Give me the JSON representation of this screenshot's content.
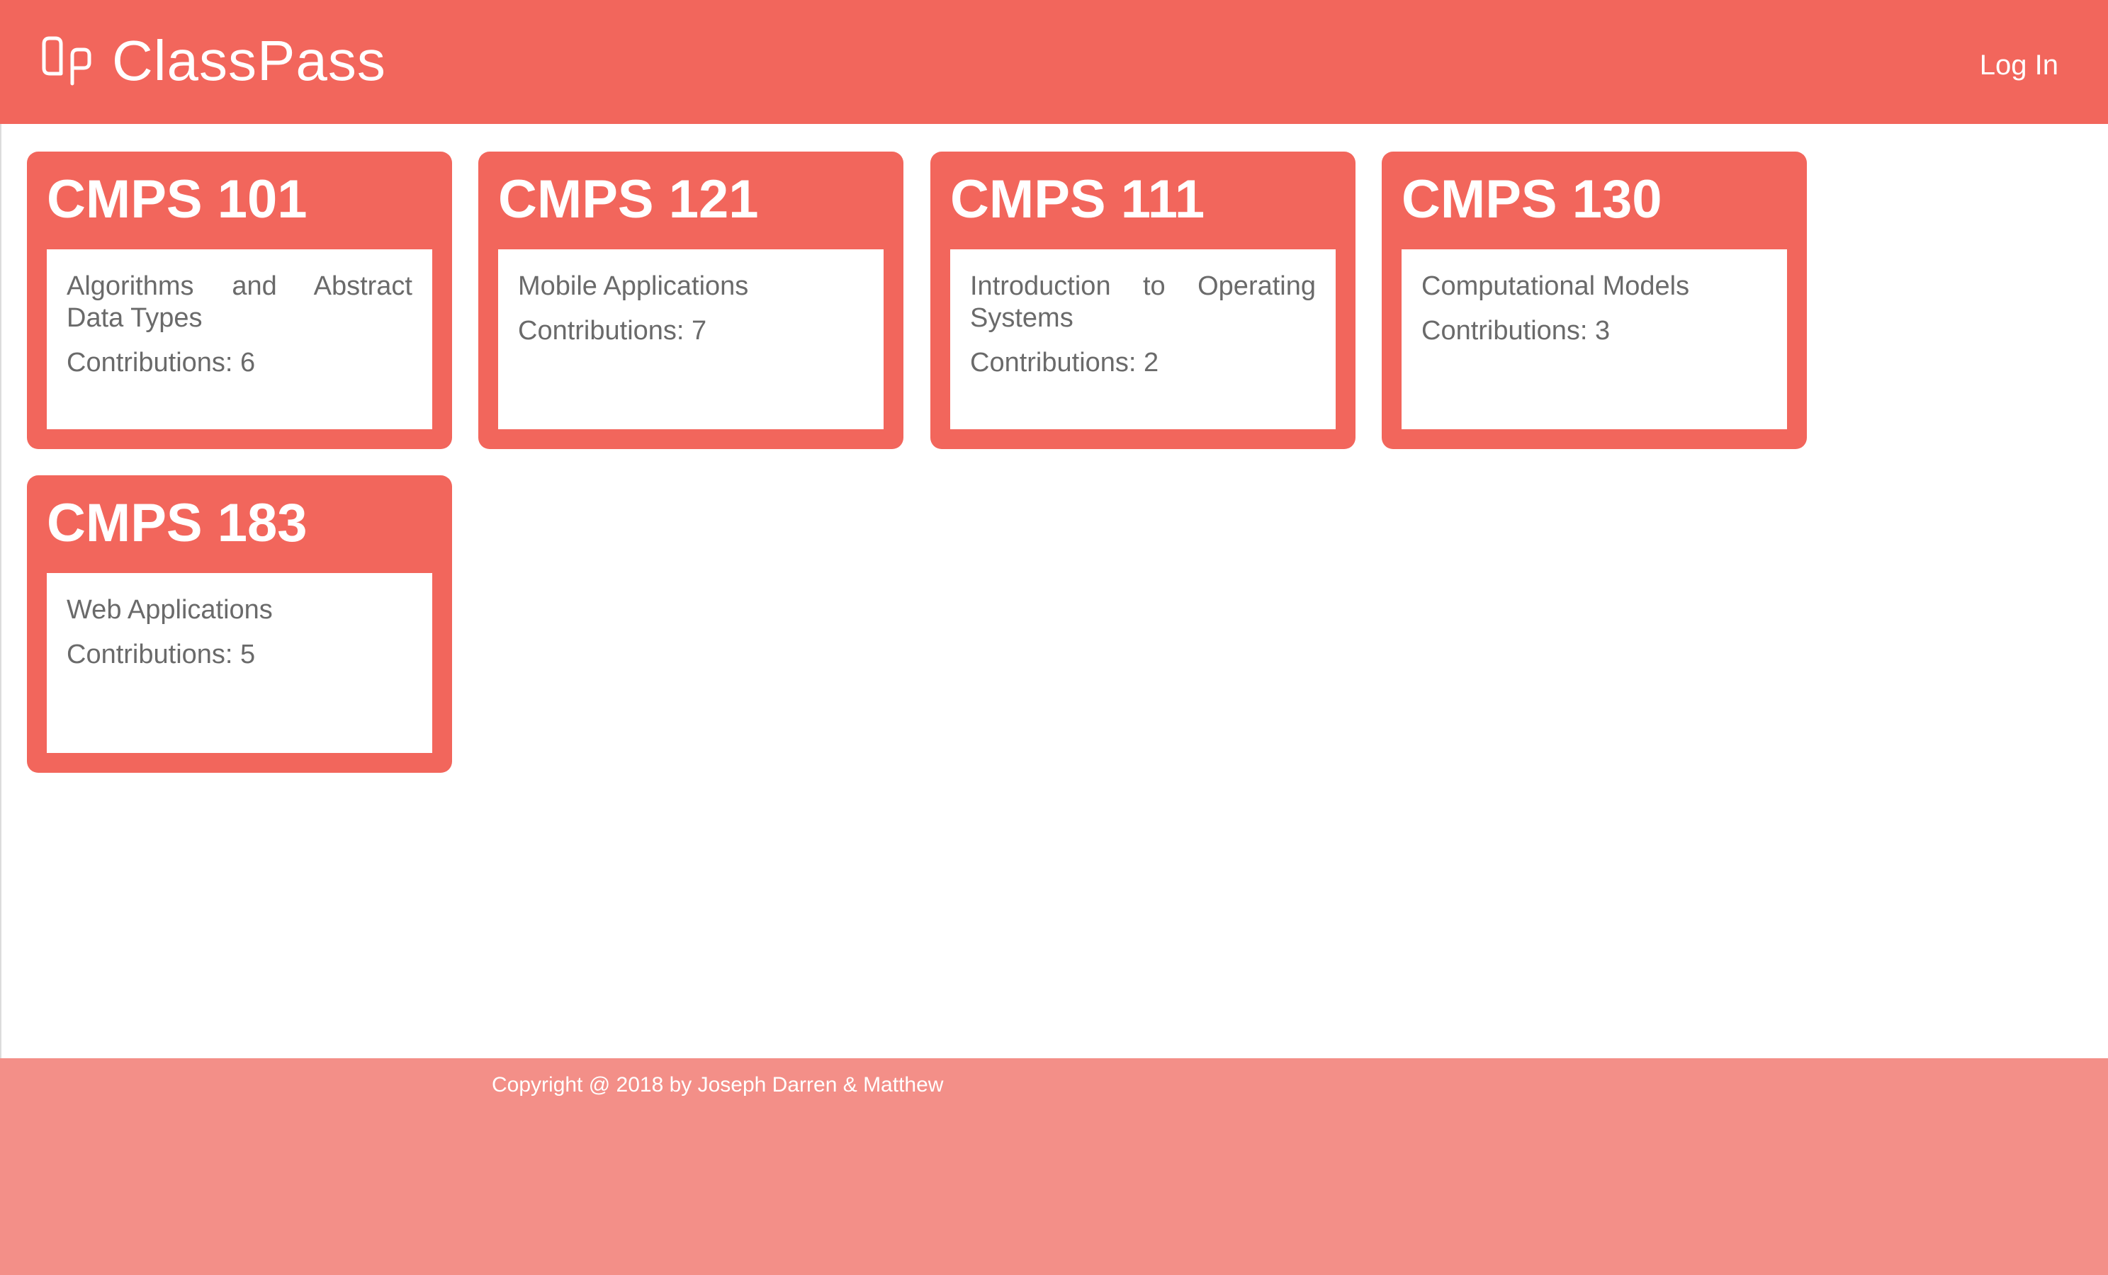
{
  "header": {
    "brand": "ClassPass",
    "login_label": "Log In"
  },
  "courses": [
    {
      "code": "CMPS 101",
      "title": "Algorithms and Abstract Data Types",
      "contributions": "Contributions: 6"
    },
    {
      "code": "CMPS 121",
      "title": "Mobile Applications",
      "contributions": "Contributions: 7"
    },
    {
      "code": "CMPS 111",
      "title": "Introduction to Operating Systems",
      "contributions": "Contributions: 2"
    },
    {
      "code": "CMPS 130",
      "title": "Computational Models",
      "contributions": "Contributions: 3"
    },
    {
      "code": "CMPS 183",
      "title": "Web Applications",
      "contributions": "Contributions: 5"
    }
  ],
  "footer": {
    "copyright": "Copyright @ 2018 by Joseph Darren & Matthew"
  },
  "colors": {
    "primary": "#f2665c",
    "footer": "#f38f88",
    "text_muted": "#6a6a6a"
  },
  "icons": {
    "brand": "classpass-logo-icon"
  }
}
